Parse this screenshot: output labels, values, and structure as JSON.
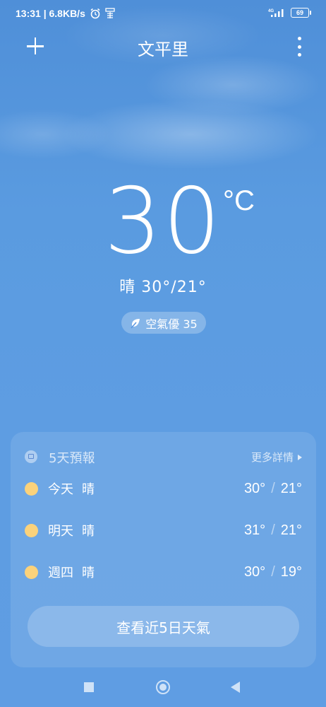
{
  "status_bar": {
    "time_speed": "13:31 | 6.8KB/s",
    "alarm_icon": "alarm-clock-icon",
    "misc_icon": "weather-notification-icon",
    "network": "4G",
    "battery": "69"
  },
  "header": {
    "city": "文平里",
    "add_icon": "plus-icon",
    "menu_icon": "more-vertical-icon"
  },
  "current": {
    "temperature": "30",
    "unit": "°C",
    "condition_range": "晴  30°/21°",
    "aqi": "空氣優 35",
    "aqi_icon": "leaf-icon"
  },
  "forecast": {
    "title": "5天預報",
    "more": "更多詳情",
    "days": [
      {
        "day": "今天",
        "cond": "晴",
        "high": "30°",
        "low": "21°",
        "icon": "sun-icon"
      },
      {
        "day": "明天",
        "cond": "晴",
        "high": "31°",
        "low": "21°",
        "icon": "sun-icon"
      },
      {
        "day": "週四",
        "cond": "晴",
        "high": "30°",
        "low": "19°",
        "icon": "sun-icon"
      }
    ],
    "button": "查看近5日天氣"
  },
  "colors": {
    "sky": "#5e9de2",
    "sun": "#fbd27b"
  }
}
